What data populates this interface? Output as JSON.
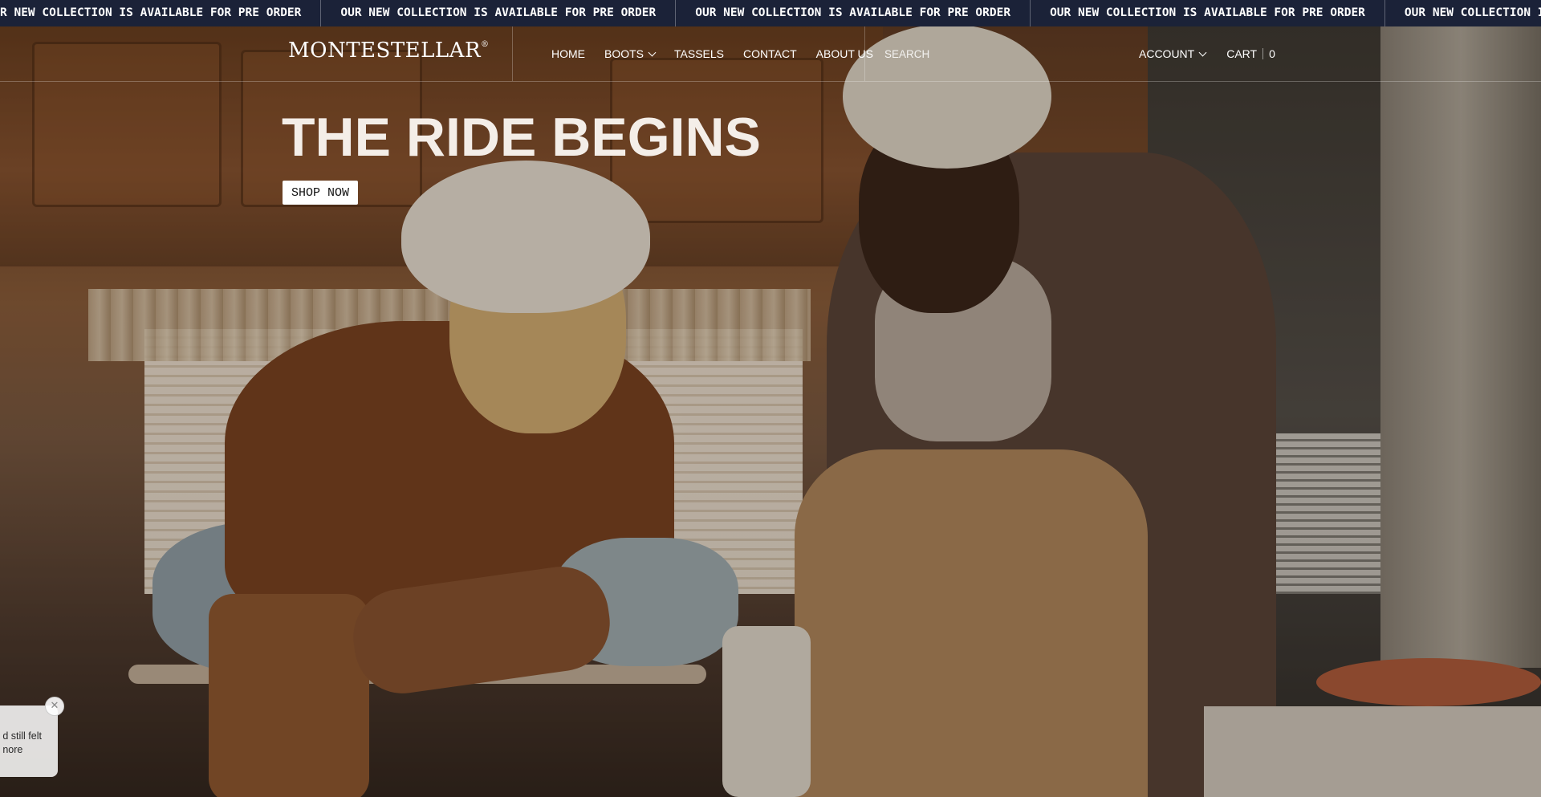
{
  "announcement": {
    "text": "OUR NEW COLLECTION IS AVAILABLE FOR PRE ORDER",
    "items": [
      "R NEW COLLECTION IS AVAILABLE FOR PRE ORDER",
      "OUR NEW COLLECTION IS AVAILABLE FOR PRE ORDER",
      "OUR NEW COLLECTION IS AVAILABLE FOR PRE ORDER",
      "OUR NEW COLLECTION IS AVAILABLE FOR PRE ORDER",
      "OUR NEW COLLECTION IS AVAILABLE FOR PRE ORDER"
    ],
    "background_color": "#1b2238"
  },
  "header": {
    "logo": "MONTESTELLAR",
    "logo_mark": "®",
    "nav": [
      {
        "label": "HOME",
        "has_dropdown": false
      },
      {
        "label": "BOOTS",
        "has_dropdown": true
      },
      {
        "label": "TASSELS",
        "has_dropdown": false
      },
      {
        "label": "CONTACT",
        "has_dropdown": false
      },
      {
        "label": "ABOUT US",
        "has_dropdown": false
      }
    ],
    "search_placeholder": "SEARCH",
    "account_label": "ACCOUNT",
    "cart_label": "CART",
    "cart_count": "0"
  },
  "hero": {
    "title": "THE RIDE BEGINS",
    "cta_label": "SHOP NOW"
  },
  "popup": {
    "line1": "d still felt",
    "line2": "nore",
    "close_icon": "close-icon"
  }
}
